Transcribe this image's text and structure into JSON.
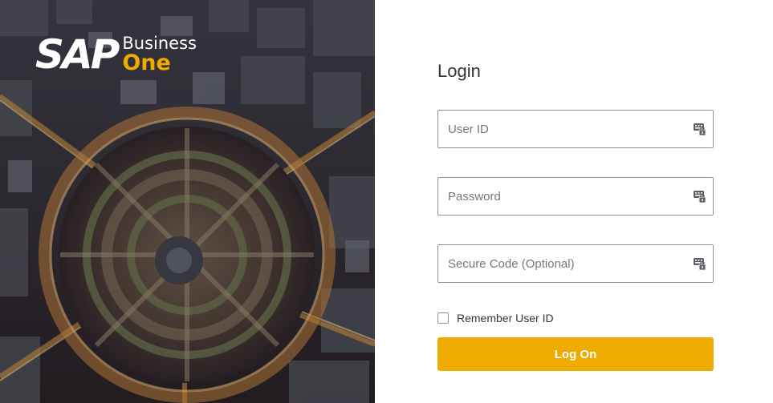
{
  "brand": {
    "logo_mark": "SAP",
    "logo_line1": "Business",
    "logo_line2": "One"
  },
  "login": {
    "title": "Login",
    "user_id": {
      "value": "",
      "placeholder": "User ID",
      "icon": "keyboard-lock-icon"
    },
    "password": {
      "value": "",
      "placeholder": "Password",
      "icon": "keyboard-lock-icon"
    },
    "secure_code": {
      "value": "",
      "placeholder": "Secure Code (Optional)",
      "icon": "keyboard-lock-icon"
    },
    "remember_label": "Remember User ID",
    "remember_checked": false,
    "logon_label": "Log On"
  },
  "colors": {
    "accent": "#f0ab00",
    "text": "#32363a",
    "border": "#89919a"
  }
}
